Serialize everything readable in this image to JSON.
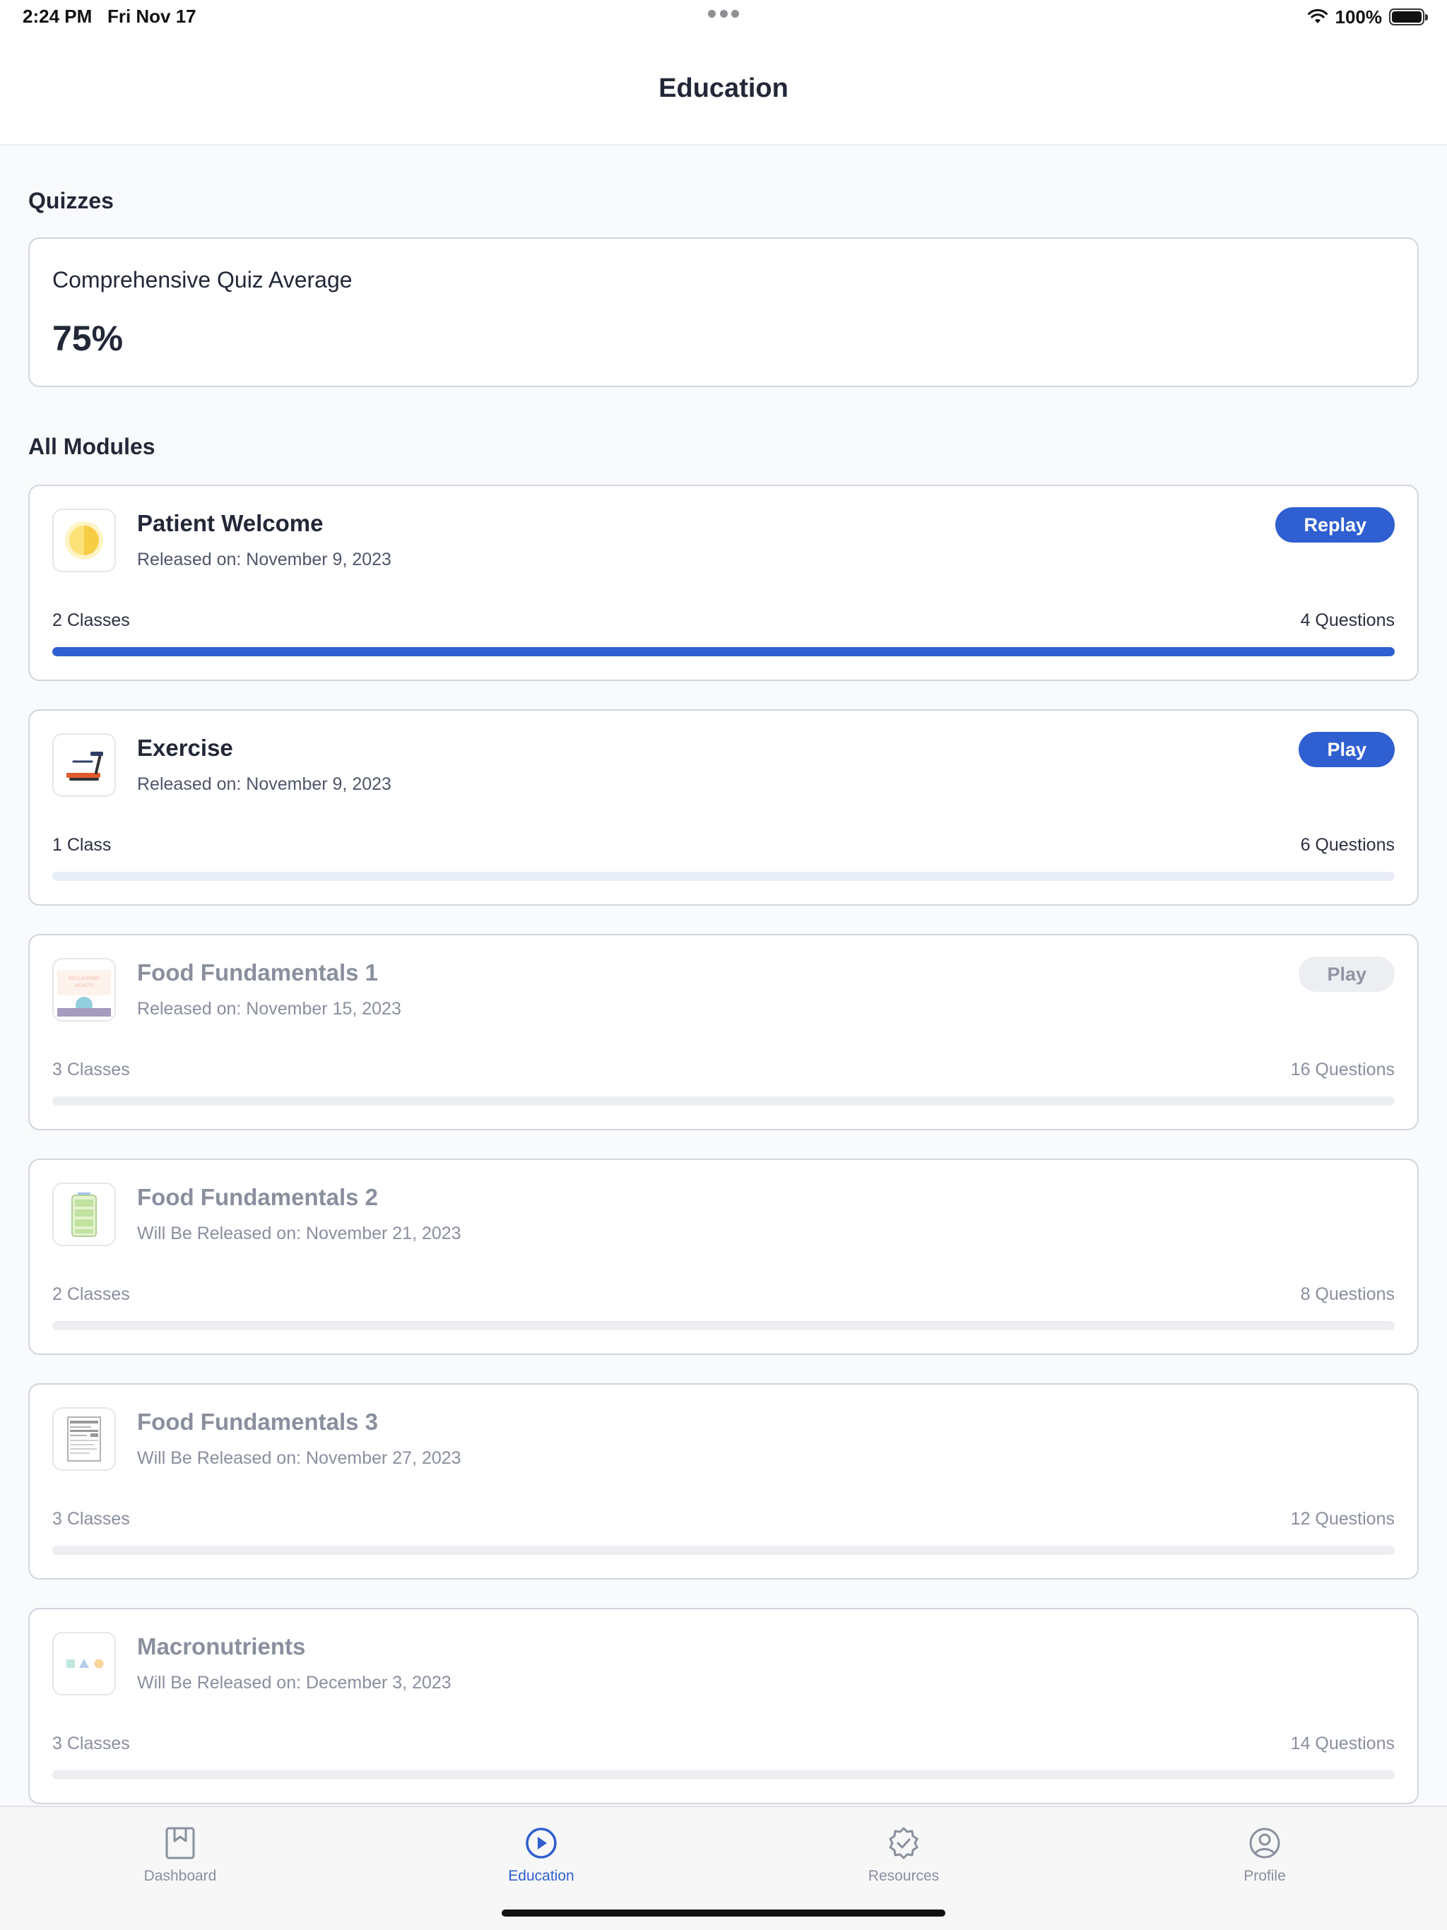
{
  "status_bar": {
    "time": "2:24 PM",
    "date": "Fri Nov 17",
    "battery": "100%"
  },
  "header": {
    "title": "Education"
  },
  "quizzes": {
    "section_title": "Quizzes",
    "card_label": "Comprehensive Quiz Average",
    "average": "75%"
  },
  "modules": {
    "section_title": "All Modules",
    "items": [
      {
        "title": "Patient Welcome",
        "date": "Released on: November 9, 2023",
        "classes": "2 Classes",
        "questions": "4 Questions",
        "button": "Replay",
        "progress": 1.0,
        "icon": "sun-icon"
      },
      {
        "title": "Exercise",
        "date": "Released on: November 9, 2023",
        "classes": "1 Class",
        "questions": "6 Questions",
        "button": "Play",
        "progress": 0.0,
        "icon": "treadmill-icon"
      },
      {
        "title": "Food Fundamentals 1",
        "date": "Released on: November 15, 2023",
        "classes": "3 Classes",
        "questions": "16 Questions",
        "button": "Play",
        "progress": 0.0,
        "icon": "reclaiming-health-icon",
        "icon_text": "RECLAIMING HEALTH"
      },
      {
        "title": "Food Fundamentals 2",
        "date": "Will Be Released on: November 21, 2023",
        "classes": "2 Classes",
        "questions": "8 Questions",
        "progress": 0.0,
        "icon": "battery-icon"
      },
      {
        "title": "Food Fundamentals 3",
        "date": "Will Be Released on: November 27, 2023",
        "classes": "3 Classes",
        "questions": "12 Questions",
        "progress": 0.0,
        "icon": "nutrition-facts-icon"
      },
      {
        "title": "Macronutrients",
        "date": "Will Be Released on: December 3, 2023",
        "classes": "3 Classes",
        "questions": "14 Questions",
        "progress": 0.0,
        "icon": "macronutrients-icon"
      }
    ]
  },
  "tabs": [
    {
      "label": "Dashboard",
      "icon": "dashboard-icon",
      "active": false
    },
    {
      "label": "Education",
      "icon": "play-circle-icon",
      "active": true
    },
    {
      "label": "Resources",
      "icon": "badge-check-icon",
      "active": false
    },
    {
      "label": "Profile",
      "icon": "profile-icon",
      "active": false
    }
  ],
  "colors": {
    "accent": "#2f5fd0",
    "text": "#232838",
    "muted": "#8a8f9e",
    "border": "#d2d5de"
  }
}
